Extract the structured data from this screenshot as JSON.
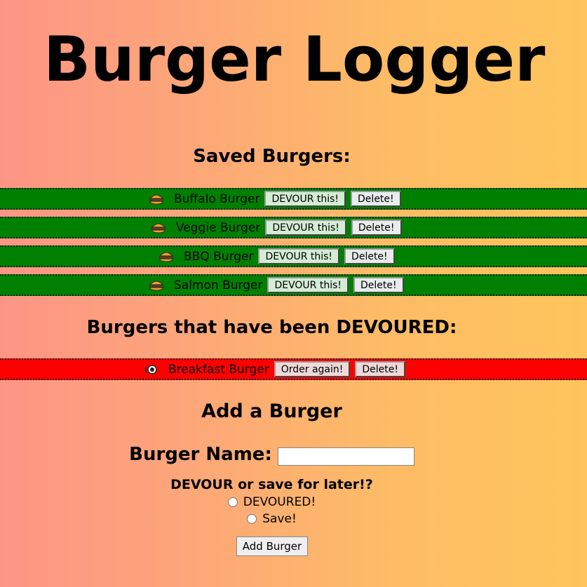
{
  "header": {
    "title": "Burger Logger"
  },
  "saved": {
    "heading": "Saved Burgers:",
    "row_color": "#008000",
    "items": [
      {
        "name": "Buffalo Burger",
        "icon": "burger-icon",
        "devour_label": "DEVOUR this!",
        "delete_label": "Delete!"
      },
      {
        "name": "Veggie Burger",
        "icon": "burger-icon",
        "devour_label": "DEVOUR this!",
        "delete_label": "Delete!"
      },
      {
        "name": "BBQ Burger",
        "icon": "burger-icon",
        "devour_label": "DEVOUR this!",
        "delete_label": "Delete!"
      },
      {
        "name": "Salmon Burger",
        "icon": "burger-icon",
        "devour_label": "DEVOUR this!",
        "delete_label": "Delete!"
      }
    ]
  },
  "devoured": {
    "heading": "Burgers that have been DEVOURED:",
    "row_color": "#ff0000",
    "items": [
      {
        "name": "Breakfast Burger",
        "icon": "plate-icon",
        "order_label": "Order again!",
        "delete_label": "Delete!"
      }
    ]
  },
  "form": {
    "heading": "Add a Burger",
    "name_label": "Burger Name:",
    "name_value": "",
    "question": "DEVOUR or save for later!?",
    "options": [
      {
        "label": "DEVOURED!",
        "checked": false
      },
      {
        "label": "Save!",
        "checked": false
      }
    ],
    "submit_label": "Add Burger"
  }
}
